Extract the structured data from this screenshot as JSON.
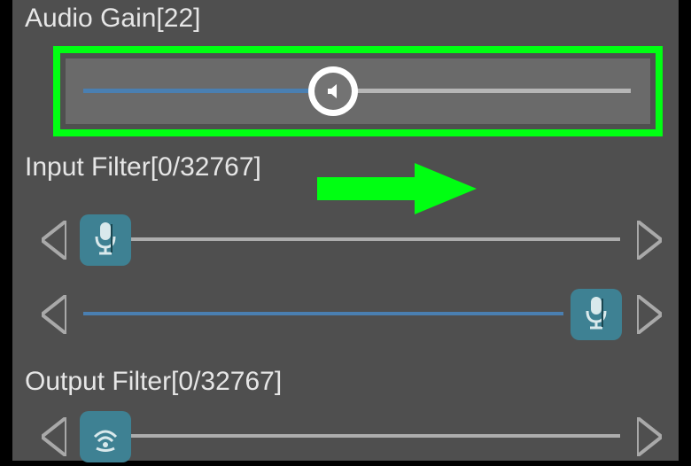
{
  "audioGain": {
    "label": "Audio Gain[22]",
    "value": 22
  },
  "inputFilter": {
    "label": "Input Filter[0/32767]",
    "low": 0,
    "high": 32767
  },
  "outputFilter": {
    "label": "Output Filter[0/32767]",
    "low": 0,
    "high": 32767
  },
  "colors": {
    "highlight": "#00ff12",
    "surface": "#4f4f4f",
    "thumb": "#3e8193"
  }
}
